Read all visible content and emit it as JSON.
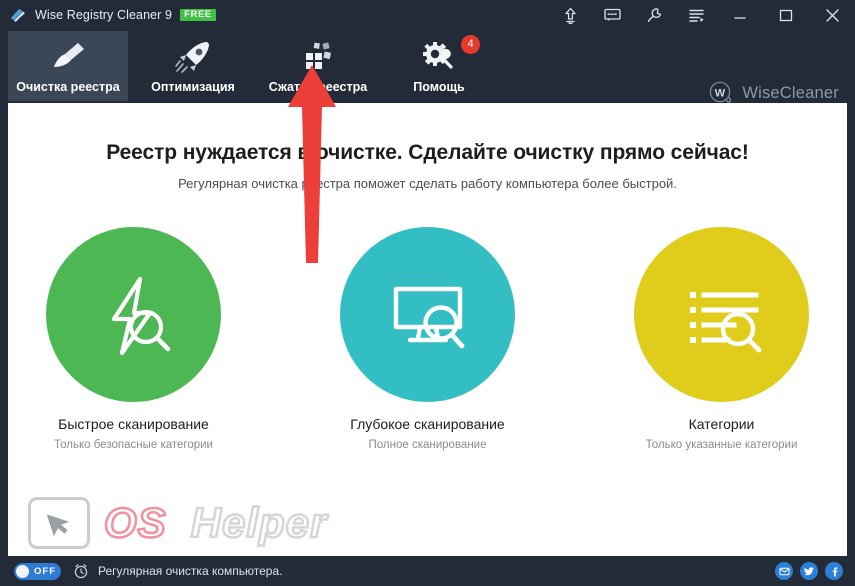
{
  "window": {
    "title": "Wise Registry Cleaner 9",
    "badge": "FREE",
    "app_icon": "broom-icon"
  },
  "titlebar": {
    "buttons": [
      {
        "name": "upgrade-icon",
        "tooltip": "Upgrade"
      },
      {
        "name": "feedback-icon",
        "tooltip": "Feedback"
      },
      {
        "name": "tools-icon",
        "tooltip": "Tools"
      },
      {
        "name": "menu-icon",
        "tooltip": "Menu"
      },
      {
        "name": "minimize-icon",
        "tooltip": "Minimize"
      },
      {
        "name": "maximize-icon",
        "tooltip": "Maximize"
      },
      {
        "name": "close-icon",
        "tooltip": "Close"
      }
    ]
  },
  "tabs": [
    {
      "label": "Очистка реестра",
      "icon": "broom-icon",
      "active": true,
      "badge": ""
    },
    {
      "label": "Оптимизация",
      "icon": "rocket-icon",
      "active": false,
      "badge": ""
    },
    {
      "label": "Сжатие реестра",
      "icon": "squares-icon",
      "active": false,
      "badge": ""
    },
    {
      "label": "Помощь",
      "icon": "gear-wrench-icon",
      "active": false,
      "badge": "4"
    }
  ],
  "brand": {
    "name": "WiseCleaner",
    "mark": "W"
  },
  "main": {
    "headline": "Реестр нуждается в очистке. Сделайте очистку прямо сейчас!",
    "subhead": "Регулярная очистка реестра поможет сделать работу компьютера более быстрой.",
    "options": [
      {
        "title": "Быстрое сканирование",
        "desc": "Только безопасные категории",
        "color": "#4cb753",
        "icon": "bolt-search-icon"
      },
      {
        "title": "Глубокое сканирование",
        "desc": "Полное сканирование",
        "color": "#33bec4",
        "icon": "monitor-search-icon"
      },
      {
        "title": "Категории",
        "desc": "Только указанные категории",
        "color": "#e0cc1b",
        "icon": "list-search-icon"
      }
    ]
  },
  "watermark": {
    "part1": "OS",
    "part2": "Helper",
    "icon": "cursor-box-icon"
  },
  "statusbar": {
    "toggle_label": "OFF",
    "toggle_on": false,
    "clock_icon": "alarm-clock-icon",
    "text": "Регулярная очистка компьютера.",
    "socials": [
      {
        "name": "email-icon",
        "glyph": "✉"
      },
      {
        "name": "twitter-icon",
        "glyph": "t"
      },
      {
        "name": "facebook-icon",
        "glyph": "f"
      }
    ]
  },
  "annotation": {
    "type": "red-arrow",
    "points_to": "Сжатие реестра"
  },
  "colors": {
    "chrome": "#232b38",
    "active_tab": "#3b4657",
    "free_badge": "#3fc144",
    "notification_badge": "#e8392f",
    "toggle": "#2f7bd4",
    "arrow": "#ec3f39"
  }
}
